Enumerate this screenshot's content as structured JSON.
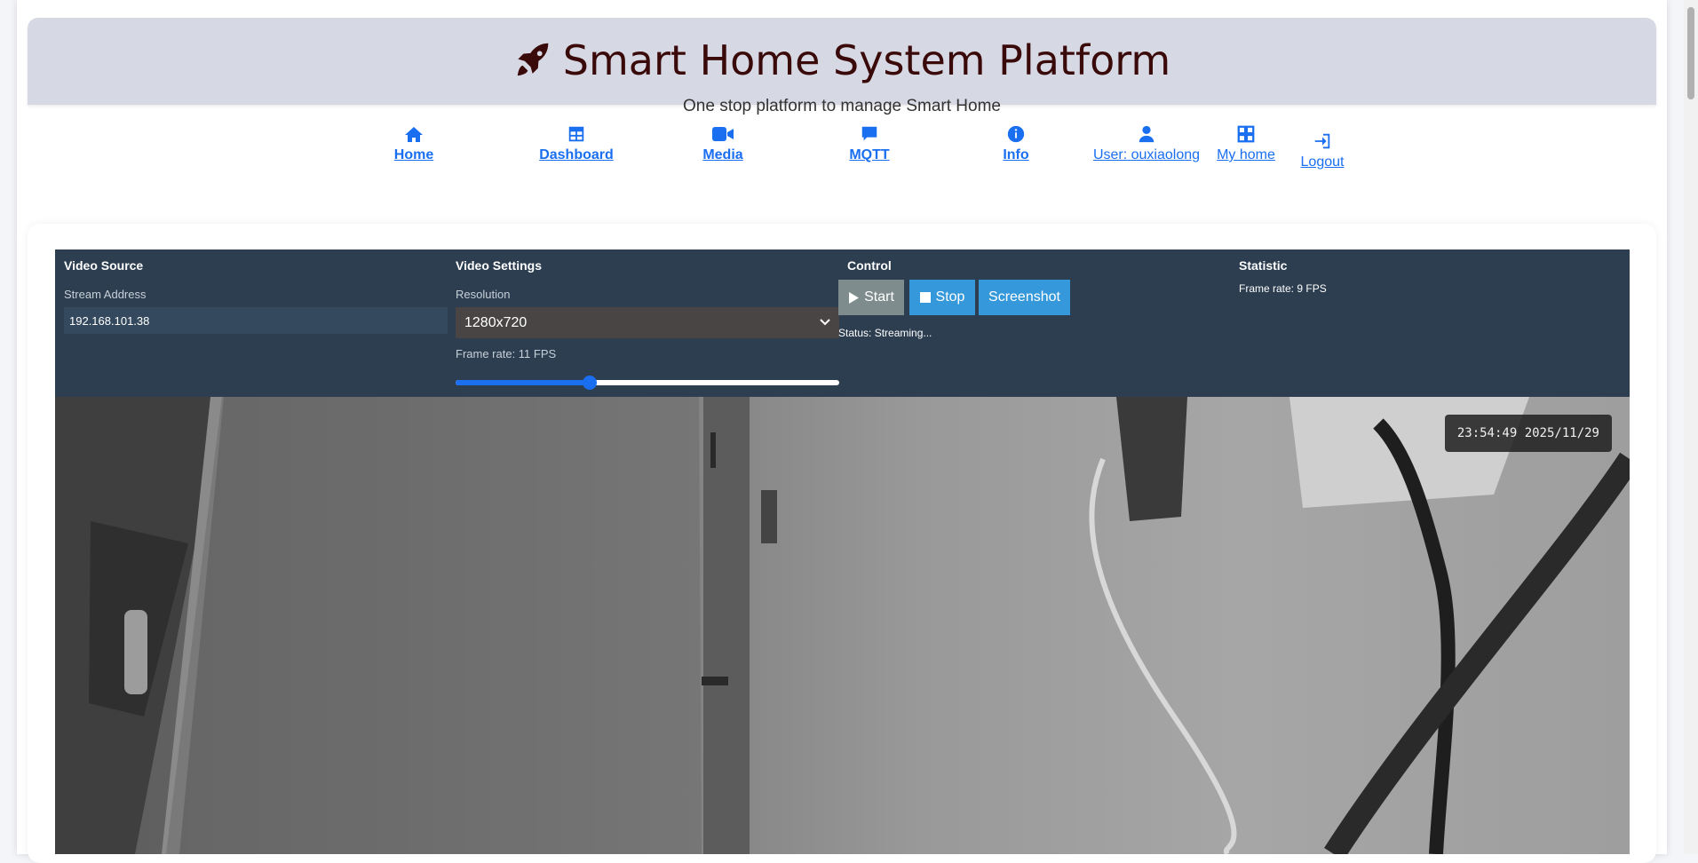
{
  "header": {
    "title": "Smart Home System Platform",
    "subtitle": "One stop platform to manage Smart Home"
  },
  "nav": [
    {
      "label": "Home",
      "icon": "home-icon"
    },
    {
      "label": "Dashboard",
      "icon": "table-icon"
    },
    {
      "label": "Media",
      "icon": "video-camera-icon"
    },
    {
      "label": "MQTT",
      "icon": "message-icon"
    },
    {
      "label": "Info",
      "icon": "info-icon"
    },
    {
      "label": "User: ouxiaolong",
      "icon": "user-icon"
    },
    {
      "label": "My home",
      "icon": "grid-icon"
    },
    {
      "label": "Logout",
      "icon": "logout-icon"
    }
  ],
  "video_source": {
    "heading": "Video Source",
    "stream_label": "Stream Address",
    "stream_value": "192.168.101.38"
  },
  "video_settings": {
    "heading": "Video Settings",
    "resolution_label": "Resolution",
    "resolution_value": "1280x720",
    "frame_rate_label": "Frame rate: 11 FPS",
    "frame_rate_fraction": 0.35
  },
  "control": {
    "heading": "Control",
    "start_label": "Start",
    "stop_label": "Stop",
    "screenshot_label": "Screenshot",
    "status": "Status: Streaming..."
  },
  "statistic": {
    "heading": "Statistic",
    "frame_rate": "Frame rate: 9 FPS"
  },
  "video": {
    "timestamp": "23:54:49 2025/11/29"
  },
  "colors": {
    "header_bg": "#d6d9e3",
    "title": "#3a0a0a",
    "nav_link": "#1a6ff0",
    "control_bg": "#2c3e50",
    "button_blue": "#3498db",
    "button_gray": "#7f8c8d"
  }
}
